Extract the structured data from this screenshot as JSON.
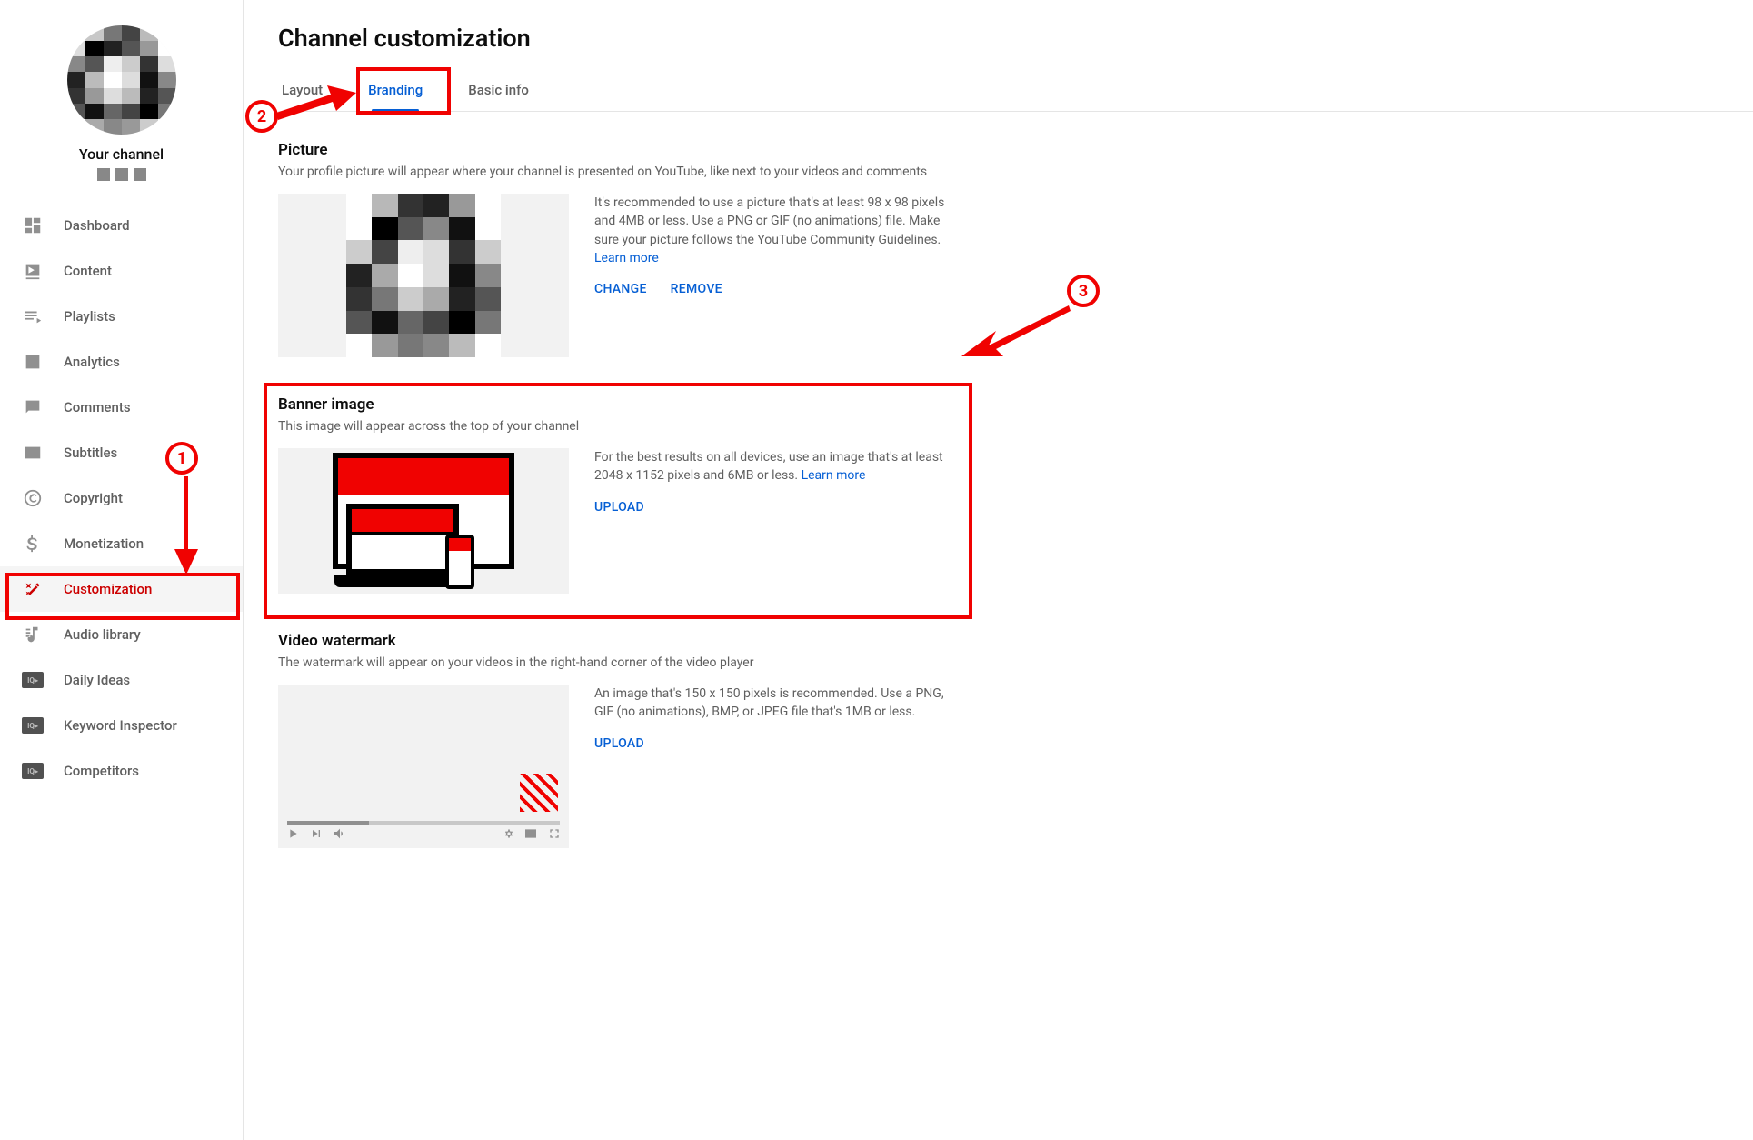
{
  "sidebar": {
    "channel_label": "Your channel",
    "items": [
      {
        "label": "Dashboard",
        "icon": "dashboard"
      },
      {
        "label": "Content",
        "icon": "content"
      },
      {
        "label": "Playlists",
        "icon": "playlists"
      },
      {
        "label": "Analytics",
        "icon": "analytics"
      },
      {
        "label": "Comments",
        "icon": "comments"
      },
      {
        "label": "Subtitles",
        "icon": "subtitles"
      },
      {
        "label": "Copyright",
        "icon": "copyright"
      },
      {
        "label": "Monetization",
        "icon": "monetization"
      },
      {
        "label": "Customization",
        "icon": "customization",
        "active": true
      },
      {
        "label": "Audio library",
        "icon": "audio"
      },
      {
        "label": "Daily Ideas",
        "icon": "iq"
      },
      {
        "label": "Keyword Inspector",
        "icon": "iq"
      },
      {
        "label": "Competitors",
        "icon": "iq"
      }
    ]
  },
  "page": {
    "title": "Channel customization",
    "tabs": [
      {
        "label": "Layout"
      },
      {
        "label": "Branding",
        "active": true
      },
      {
        "label": "Basic info"
      }
    ]
  },
  "sections": {
    "picture": {
      "title": "Picture",
      "desc": "Your profile picture will appear where your channel is presented on YouTube, like next to your videos and comments",
      "help": "It's recommended to use a picture that's at least 98 x 98 pixels and 4MB or less. Use a PNG or GIF (no animations) file. Make sure your picture follows the YouTube Community Guidelines. ",
      "learn": "Learn more",
      "btn_change": "CHANGE",
      "btn_remove": "REMOVE"
    },
    "banner": {
      "title": "Banner image",
      "desc": "This image will appear across the top of your channel",
      "help": "For the best results on all devices, use an image that's at least 2048 x 1152 pixels and 6MB or less. ",
      "learn": "Learn more",
      "btn_upload": "UPLOAD"
    },
    "watermark": {
      "title": "Video watermark",
      "desc": "The watermark will appear on your videos in the right-hand corner of the video player",
      "help": "An image that's 150 x 150 pixels is recommended. Use a PNG, GIF (no animations), BMP, or JPEG file that's 1MB or less.",
      "btn_upload": "UPLOAD"
    }
  },
  "annotations": {
    "n1": "1",
    "n2": "2",
    "n3": "3"
  }
}
